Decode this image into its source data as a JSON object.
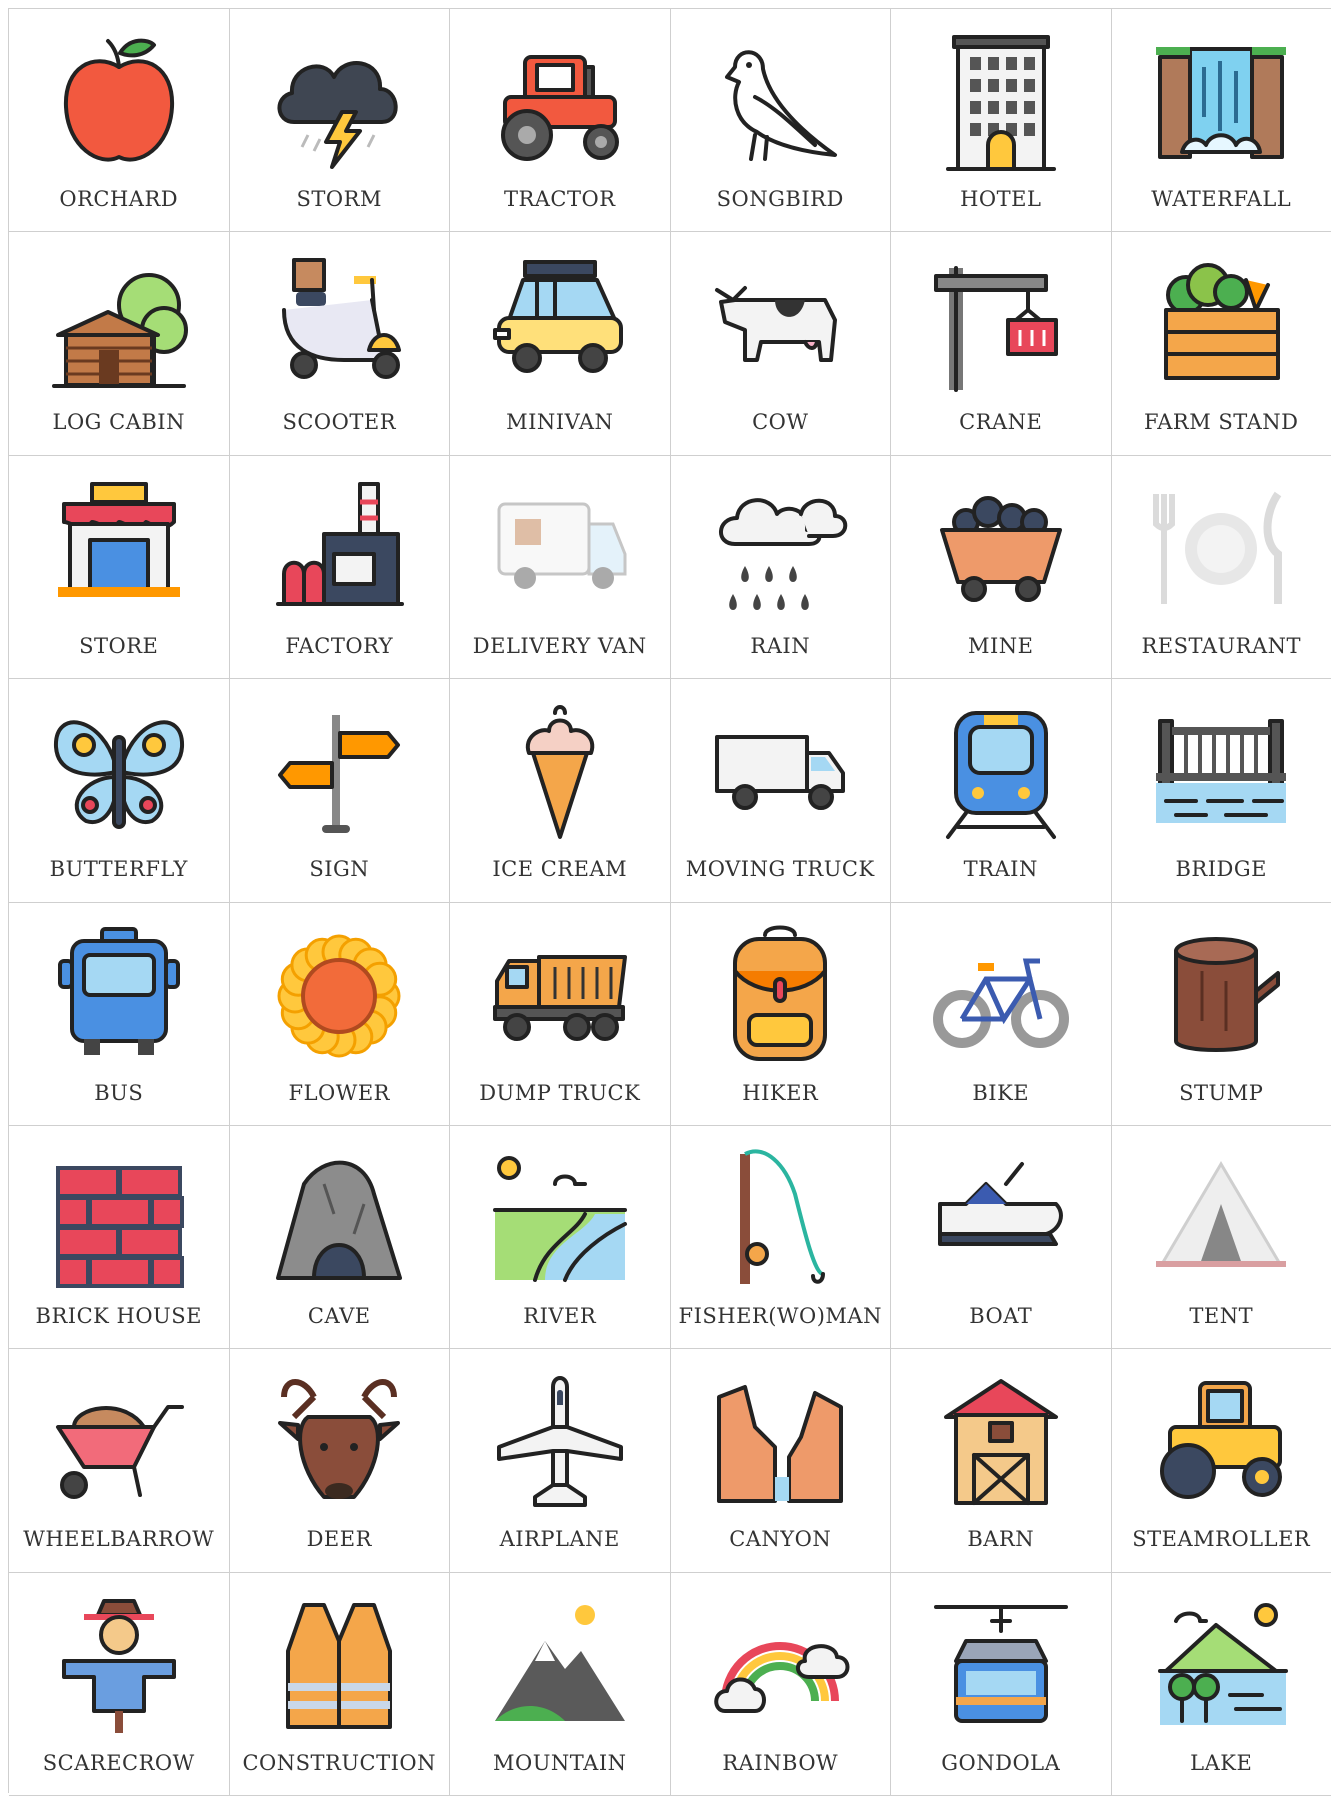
{
  "cards": [
    {
      "label": "ORCHARD",
      "icon": "apple-icon"
    },
    {
      "label": "STORM",
      "icon": "storm-cloud-icon"
    },
    {
      "label": "TRACTOR",
      "icon": "tractor-icon"
    },
    {
      "label": "SONGBIRD",
      "icon": "songbird-icon"
    },
    {
      "label": "HOTEL",
      "icon": "hotel-icon"
    },
    {
      "label": "WATERFALL",
      "icon": "waterfall-icon"
    },
    {
      "label": "LOG CABIN",
      "icon": "log-cabin-icon"
    },
    {
      "label": "SCOOTER",
      "icon": "scooter-icon"
    },
    {
      "label": "MINIVAN",
      "icon": "minivan-icon"
    },
    {
      "label": "COW",
      "icon": "cow-icon"
    },
    {
      "label": "CRANE",
      "icon": "crane-icon"
    },
    {
      "label": "FARM STAND",
      "icon": "farm-stand-icon"
    },
    {
      "label": "STORE",
      "icon": "store-icon"
    },
    {
      "label": "FACTORY",
      "icon": "factory-icon"
    },
    {
      "label": "DELIVERY VAN",
      "icon": "delivery-van-icon"
    },
    {
      "label": "RAIN",
      "icon": "rain-cloud-icon"
    },
    {
      "label": "MINE",
      "icon": "mine-cart-icon"
    },
    {
      "label": "RESTAURANT",
      "icon": "restaurant-icon"
    },
    {
      "label": "BUTTERFLY",
      "icon": "butterfly-icon"
    },
    {
      "label": "SIGN",
      "icon": "signpost-icon"
    },
    {
      "label": "ICE CREAM",
      "icon": "ice-cream-icon"
    },
    {
      "label": "MOVING TRUCK",
      "icon": "moving-truck-icon"
    },
    {
      "label": "TRAIN",
      "icon": "train-icon"
    },
    {
      "label": "BRIDGE",
      "icon": "bridge-icon"
    },
    {
      "label": "BUS",
      "icon": "bus-icon"
    },
    {
      "label": "FLOWER",
      "icon": "sunflower-icon"
    },
    {
      "label": "DUMP TRUCK",
      "icon": "dump-truck-icon"
    },
    {
      "label": "HIKER",
      "icon": "backpack-icon"
    },
    {
      "label": "BIKE",
      "icon": "bicycle-icon"
    },
    {
      "label": "STUMP",
      "icon": "stump-icon"
    },
    {
      "label": "BRICK HOUSE",
      "icon": "brick-wall-icon"
    },
    {
      "label": "CAVE",
      "icon": "cave-icon"
    },
    {
      "label": "RIVER",
      "icon": "river-icon"
    },
    {
      "label": "FISHER(WO)MAN",
      "icon": "fishing-rod-icon"
    },
    {
      "label": "BOAT",
      "icon": "jet-ski-icon"
    },
    {
      "label": "TENT",
      "icon": "tent-icon"
    },
    {
      "label": "WHEELBARROW",
      "icon": "wheelbarrow-icon"
    },
    {
      "label": "DEER",
      "icon": "deer-icon"
    },
    {
      "label": "AIRPLANE",
      "icon": "airplane-icon"
    },
    {
      "label": "CANYON",
      "icon": "canyon-icon"
    },
    {
      "label": "BARN",
      "icon": "barn-icon"
    },
    {
      "label": "STEAMROLLER",
      "icon": "steamroller-icon"
    },
    {
      "label": "SCARECROW",
      "icon": "scarecrow-icon"
    },
    {
      "label": "CONSTRUCTION",
      "icon": "safety-vest-icon"
    },
    {
      "label": "MOUNTAIN",
      "icon": "mountain-icon"
    },
    {
      "label": "RAINBOW",
      "icon": "rainbow-icon"
    },
    {
      "label": "GONDOLA",
      "icon": "gondola-icon"
    },
    {
      "label": "LAKE",
      "icon": "lake-icon"
    }
  ]
}
